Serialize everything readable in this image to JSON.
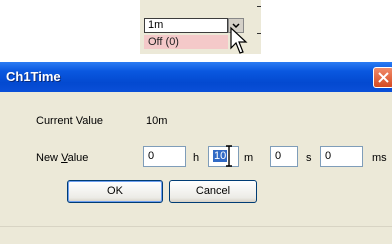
{
  "background_dropdown": {
    "selected_value": "1m",
    "highlighted_option": "Off (0)"
  },
  "dialog": {
    "title": "Ch1Time",
    "current_value_label": "Current Value",
    "current_value": "10m",
    "new_value_label_mnemonic": "V",
    "new_value_label_prefix": "New ",
    "new_value_label_suffix": "alue",
    "fields": {
      "hours": "0",
      "minutes": "10",
      "seconds": "0",
      "milliseconds": "0"
    },
    "units": {
      "hours": "h",
      "minutes": "m",
      "seconds": "s",
      "milliseconds": "ms"
    },
    "ok_label": "OK",
    "cancel_label": "Cancel"
  },
  "colors": {
    "titlebar": "#0a58e0",
    "dialog_bg": "#ece9d8",
    "selection": "#316ac5",
    "option_highlight": "#f4c9c9"
  },
  "icons": [
    "chevron-down-icon",
    "mouse-cursor-icon",
    "close-icon",
    "text-cursor-icon"
  ]
}
